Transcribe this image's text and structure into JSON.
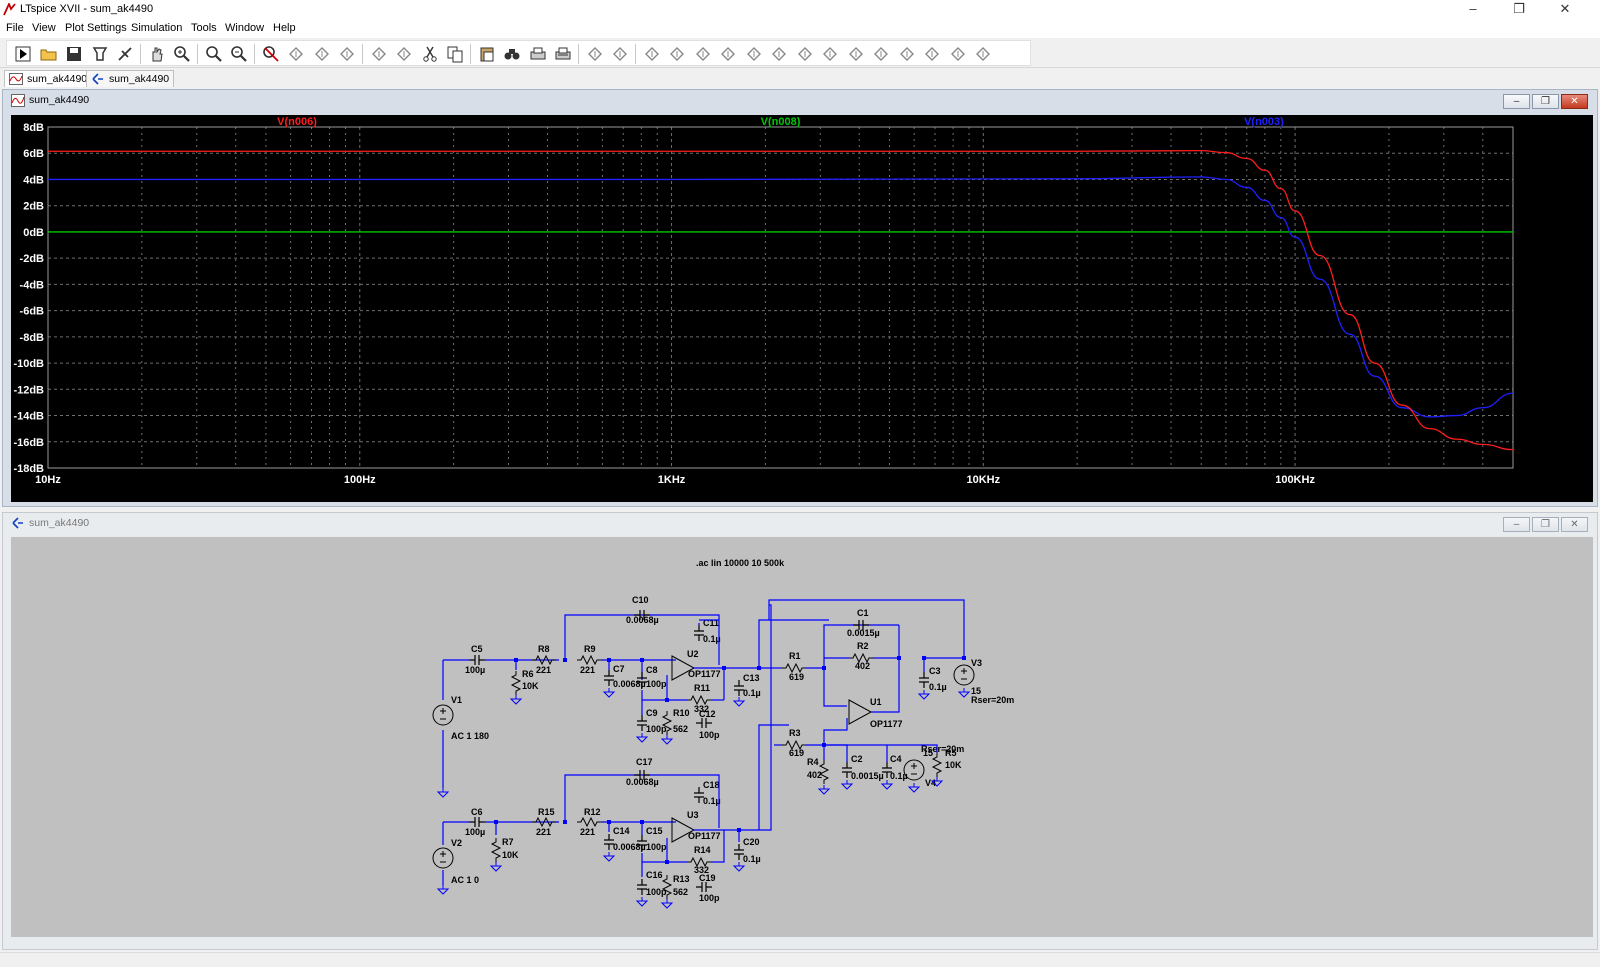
{
  "window": {
    "title": "LTspice XVII - sum_ak4490",
    "minimize": "–",
    "restore": "❐",
    "close": "✕"
  },
  "menu": [
    "File",
    "View",
    "Plot Settings",
    "Simulation",
    "Tools",
    "Window",
    "Help"
  ],
  "toolbar_icons": [
    "run-icon",
    "open-icon",
    "save-icon",
    "control-panel-icon",
    "halt-icon",
    "pan-hand-icon",
    "zoom-in-icon",
    "zoom-area-icon",
    "zoom-out-icon",
    "zoom-fit-icon",
    "autorange-icon",
    "markers-icon",
    "tile-horizontal-icon",
    "cascade-icon",
    "tile-vertical-icon",
    "cut-icon",
    "copy-icon",
    "paste-icon",
    "find-icon",
    "print-icon",
    "print-preview-icon",
    "draw-wire-icon",
    "ground-icon",
    "label-net-icon",
    "resistor-icon",
    "capacitor-icon",
    "inductor-icon",
    "diode-icon",
    "component-icon",
    "move-icon",
    "drag-icon",
    "undo-icon",
    "redo-icon",
    "rotate-icon",
    "mirror-icon",
    "text-icon",
    "spice-directive-icon"
  ],
  "tabs": [
    {
      "label": "sum_ak4490",
      "icon": "waveform-icon"
    },
    {
      "label": "sum_ak4490",
      "icon": "schematic-icon"
    }
  ],
  "plot_window": {
    "title": "sum_ak4490",
    "icon": "waveform-icon"
  },
  "schematic_window": {
    "title": "sum_ak4490",
    "icon": "schematic-icon",
    "directive": ".ac lin 10000 10 500k",
    "components": [
      {
        "ref": "C10",
        "value": "0.0068µ"
      },
      {
        "ref": "C11",
        "value": "0.1µ"
      },
      {
        "ref": "C1",
        "value": "0.0015µ"
      },
      {
        "ref": "R2",
        "value": "402"
      },
      {
        "ref": "C5",
        "value": "100µ"
      },
      {
        "ref": "R8",
        "value": "221"
      },
      {
        "ref": "R9",
        "value": "221"
      },
      {
        "ref": "R6",
        "value": "10K"
      },
      {
        "ref": "C7",
        "value": "0.0068µ"
      },
      {
        "ref": "C8",
        "value": "100p"
      },
      {
        "ref": "U2",
        "value": "OP1177"
      },
      {
        "ref": "R1",
        "value": "619"
      },
      {
        "ref": "C13",
        "value": "0.1µ"
      },
      {
        "ref": "R11",
        "value": "332"
      },
      {
        "ref": "C3",
        "value": "0.1µ"
      },
      {
        "ref": "V3",
        "value": "15"
      },
      {
        "ref": "V3-rser",
        "value": "Rser=20m"
      },
      {
        "ref": "V1",
        "value": "AC 1 180"
      },
      {
        "ref": "C9",
        "value": "100p"
      },
      {
        "ref": "R10",
        "value": "562"
      },
      {
        "ref": "C12",
        "value": "100p"
      },
      {
        "ref": "U1",
        "value": "OP1177"
      },
      {
        "ref": "R3",
        "value": "619"
      },
      {
        "ref": "R4",
        "value": "402"
      },
      {
        "ref": "C2",
        "value": "0.0015µ"
      },
      {
        "ref": "C4",
        "value": "0.1µ"
      },
      {
        "ref": "V4",
        "value": "15"
      },
      {
        "ref": "V4-rser",
        "value": "Rser=20m"
      },
      {
        "ref": "R5",
        "value": "10K"
      },
      {
        "ref": "C17",
        "value": "0.0068µ"
      },
      {
        "ref": "C18",
        "value": "0.1µ"
      },
      {
        "ref": "C6",
        "value": "100µ"
      },
      {
        "ref": "R15",
        "value": "221"
      },
      {
        "ref": "R12",
        "value": "221"
      },
      {
        "ref": "R7",
        "value": "10K"
      },
      {
        "ref": "C14",
        "value": "0.0068µ"
      },
      {
        "ref": "C15",
        "value": "100p"
      },
      {
        "ref": "U3",
        "value": "OP1177"
      },
      {
        "ref": "R14",
        "value": "332"
      },
      {
        "ref": "C20",
        "value": "0.1µ"
      },
      {
        "ref": "V2",
        "value": "AC 1 0"
      },
      {
        "ref": "C16",
        "value": "100p"
      },
      {
        "ref": "R13",
        "value": "562"
      },
      {
        "ref": "C19",
        "value": "100p"
      }
    ]
  },
  "colors": {
    "plot_bg": "#000000",
    "grid": "#6e6e6e",
    "axis_text": "#ffffff",
    "trace_n006": "#ff1e1e",
    "trace_n008": "#00c800",
    "trace_n003": "#2020ff",
    "wire": "#0000ff",
    "schematic_bg": "#c0c0c0"
  },
  "chart_data": {
    "type": "line",
    "x_scale": "log",
    "xlim": [
      10,
      500000
    ],
    "ylim": [
      -18,
      8
    ],
    "x_ticks": [
      {
        "v": 10,
        "label": "10Hz"
      },
      {
        "v": 100,
        "label": "100Hz"
      },
      {
        "v": 1000,
        "label": "1KHz"
      },
      {
        "v": 10000,
        "label": "10KHz"
      },
      {
        "v": 100000,
        "label": "100KHz"
      }
    ],
    "y_ticks": [
      {
        "v": 8,
        "label": "8dB"
      },
      {
        "v": 6,
        "label": "6dB"
      },
      {
        "v": 4,
        "label": "4dB"
      },
      {
        "v": 2,
        "label": "2dB"
      },
      {
        "v": 0,
        "label": "0dB"
      },
      {
        "v": -2,
        "label": "-2dB"
      },
      {
        "v": -4,
        "label": "-4dB"
      },
      {
        "v": -6,
        "label": "-6dB"
      },
      {
        "v": -8,
        "label": "-8dB"
      },
      {
        "v": -10,
        "label": "-10dB"
      },
      {
        "v": -12,
        "label": "-12dB"
      },
      {
        "v": -14,
        "label": "-14dB"
      },
      {
        "v": -16,
        "label": "-16dB"
      },
      {
        "v": -18,
        "label": "-18dB"
      }
    ],
    "grid": true,
    "series": [
      {
        "name": "V(n006)",
        "color": "#ff1e1e",
        "x": [
          10,
          1000,
          20000,
          50000,
          60000,
          70000,
          80000,
          90000,
          100000,
          120000,
          150000,
          180000,
          220000,
          270000,
          330000,
          400000,
          500000
        ],
        "y": [
          6.15,
          6.15,
          6.15,
          6.2,
          6.05,
          5.6,
          4.7,
          3.3,
          1.6,
          -1.8,
          -6.3,
          -10.0,
          -13.2,
          -15.0,
          -15.8,
          -16.2,
          -16.6
        ]
      },
      {
        "name": "V(n008)",
        "color": "#00c800",
        "x": [
          10,
          500000
        ],
        "y": [
          0,
          0
        ]
      },
      {
        "name": "V(n003)",
        "color": "#2020ff",
        "x": [
          10,
          1000,
          20000,
          50000,
          60000,
          70000,
          80000,
          90000,
          100000,
          120000,
          150000,
          180000,
          220000,
          270000,
          330000,
          400000,
          500000
        ],
        "y": [
          4.0,
          4.0,
          4.05,
          4.2,
          4.0,
          3.4,
          2.4,
          1.1,
          -0.4,
          -3.6,
          -7.8,
          -11.0,
          -13.4,
          -14.1,
          -14.0,
          -13.4,
          -12.3
        ]
      }
    ]
  }
}
